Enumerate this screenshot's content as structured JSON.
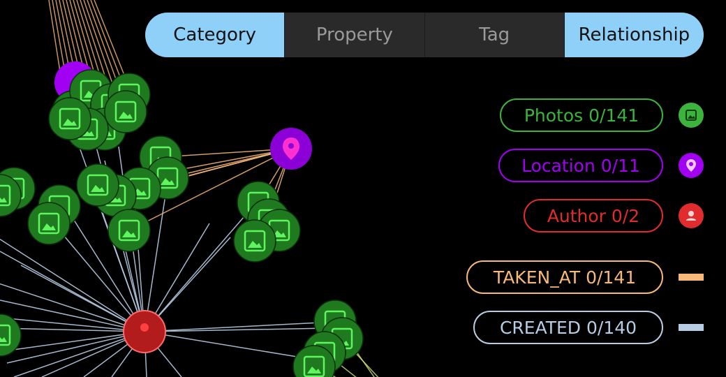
{
  "tabs": [
    {
      "label": "Category",
      "active": true
    },
    {
      "label": "Property",
      "active": false
    },
    {
      "label": "Tag",
      "active": false
    },
    {
      "label": "Relationship",
      "active": true
    }
  ],
  "legend": {
    "photos": {
      "label": "Photos 0/141",
      "color": "#3cb33c",
      "icon": "image-icon"
    },
    "location": {
      "label": "Location 0/11",
      "color": "#a100f2",
      "icon": "map-pin-icon"
    },
    "author": {
      "label": "Author 0/2",
      "color": "#e02c2c",
      "icon": "person-icon"
    },
    "taken_at": {
      "label": "TAKEN_AT 0/141",
      "color": "#f7b97a",
      "icon": "line-swatch"
    },
    "created": {
      "label": "CREATED 0/140",
      "color": "#b6cde4",
      "icon": "line-swatch"
    }
  }
}
